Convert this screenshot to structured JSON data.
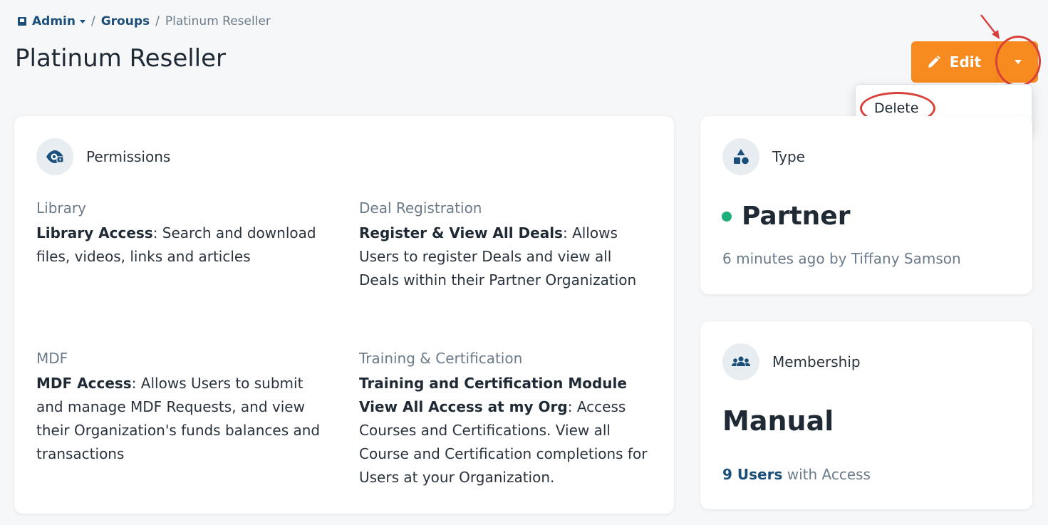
{
  "breadcrumb": {
    "admin": "Admin",
    "separator": "/",
    "groups": "Groups",
    "current": "Platinum Reseller"
  },
  "page_title": "Platinum Reseller",
  "actions": {
    "edit_label": "Edit",
    "dropdown_items": [
      "Delete"
    ]
  },
  "permissions": {
    "header": "Permissions",
    "blocks": [
      {
        "category": "Library",
        "name": "Library Access",
        "desc": ": Search and download files, videos, links and articles"
      },
      {
        "category": "Deal Registration",
        "name": "Register & View All Deals",
        "desc": ": Allows Users to register Deals and view all Deals within their Partner Organization"
      },
      {
        "category": "MDF",
        "name": "MDF Access",
        "desc": ": Allows Users to submit and manage MDF Requests, and view their Organization's funds balances and transactions"
      },
      {
        "category": "Training & Certification",
        "name": "Training and Certification Module View All Access at my Org",
        "desc": ": Access Courses and Certifications. View all Course and Certification completions for Users at your Organization."
      }
    ]
  },
  "type_card": {
    "header": "Type",
    "value": "Partner",
    "status_color": "#1bb07a",
    "meta": "6 minutes ago by Tiffany Samson"
  },
  "membership_card": {
    "header": "Membership",
    "value": "Manual",
    "users_link": "9 Users",
    "users_suffix": " with Access"
  },
  "colors": {
    "accent": "#f78b1f",
    "link": "#1b4f7a",
    "annotation": "#d8413a"
  }
}
